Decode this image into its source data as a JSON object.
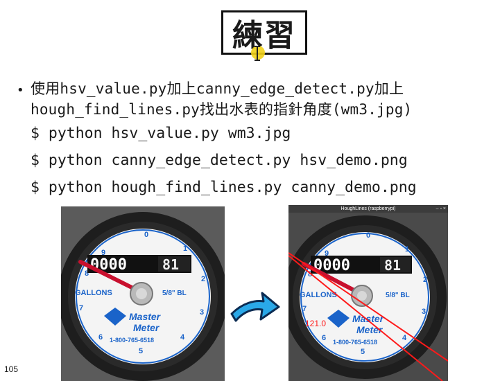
{
  "slide": {
    "title": "練習",
    "bullet_line1": "使用hsv_value.py加上canny_edge_detect.py加上",
    "bullet_line2": "hough_find_lines.py找出水表的指針角度(wm3.jpg)",
    "commands": [
      "$ python hsv_value.py wm3.jpg",
      "$ python canny_edge_detect.py hsv_demo.png",
      "$ python hough_find_lines.py canny_demo.png"
    ],
    "page_number": "105"
  },
  "meter": {
    "counter_digits": "0000",
    "counter_tail": "81",
    "gallons_label": "GALLONS",
    "size_label": "5/8\" BL",
    "brand_line1": "Master",
    "brand_line2": "Meter",
    "phone": "1-800-765-6518",
    "dial_numbers": [
      "0",
      "1",
      "2",
      "3",
      "4",
      "5",
      "6",
      "7",
      "8",
      "9"
    ]
  },
  "result_window": {
    "title": "HoughLines (raspberrypi)",
    "window_buttons": "– ▫ ×",
    "angle_text": "121.0"
  },
  "colors": {
    "dial_blue": "#1a63c9",
    "needle_red": "#c8102e",
    "hough_line_red": "#ff1a1a",
    "arrow_blue": "#2aa8e8"
  }
}
